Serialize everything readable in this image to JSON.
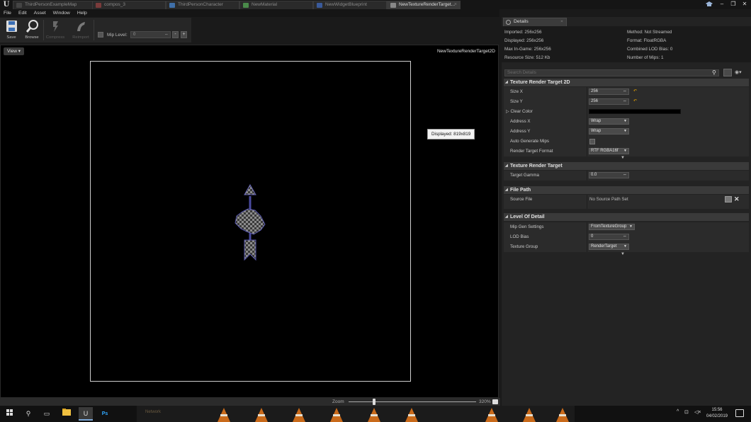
{
  "tabs": [
    {
      "label": "ThirdPersonExampleMap",
      "icon": "level-icon"
    },
    {
      "label": "compos_3",
      "icon": "animation-icon"
    },
    {
      "label": "ThirdPersonCharacter",
      "icon": "blueprint-icon"
    },
    {
      "label": "NewMaterial",
      "icon": "material-icon"
    },
    {
      "label": "NewWidgetBlueprint",
      "icon": "widget-icon"
    },
    {
      "label": "NewTextureRenderTarget...",
      "icon": "texture-icon"
    }
  ],
  "menu": [
    "File",
    "Edit",
    "Asset",
    "Window",
    "Help"
  ],
  "toolbar": {
    "save": "Save",
    "browse": "Browse",
    "compress": "Compress",
    "reimport": "Reimport",
    "mip_level_label": "Mip Level:",
    "mip_level_value": "0",
    "minus": "-",
    "plus": "+"
  },
  "viewport": {
    "view_button": "View ▾",
    "texture_name": "NewTextureRenderTarget2D",
    "tooltip": "Displayed: 819x819"
  },
  "zoom": {
    "label": "Zoom",
    "value": "320%",
    "level": 0.2
  },
  "details": {
    "tab_label": "Details",
    "info_left": [
      "Imported: 256x256",
      "Displayed: 256x256",
      "Max In-Game: 256x256",
      "Resource Size: 512 Kb"
    ],
    "info_right": [
      "Method: Not Streamed",
      "Format: FloatRGBA",
      "Combined LOD Bias: 0",
      "Number of Mips: 1"
    ],
    "search_placeholder": "Search Details",
    "sections": {
      "render_target_2d": {
        "title": "Texture Render Target 2D",
        "size_x_label": "Size X",
        "size_x": "256",
        "size_y_label": "Size Y",
        "size_y": "256",
        "clear_color_label": "Clear Color",
        "address_x_label": "Address X",
        "address_x": "Wrap",
        "address_y_label": "Address Y",
        "address_y": "Wrap",
        "auto_mips_label": "Auto Generate Mips",
        "format_label": "Render Target Format",
        "format": "RTF RGBA16f"
      },
      "render_target": {
        "title": "Texture Render Target",
        "gamma_label": "Target Gamma",
        "gamma": "0.0"
      },
      "file_path": {
        "title": "File Path",
        "source_label": "Source File",
        "source_value": "No Source Path Set"
      },
      "lod": {
        "title": "Level Of Detail",
        "mip_gen_label": "Mip Gen Settings",
        "mip_gen": "FromTextureGroup",
        "lod_bias_label": "LOD Bias",
        "lod_bias": "0",
        "texture_group_label": "Texture Group",
        "texture_group": "RenderTarget"
      }
    }
  },
  "taskbar": {
    "network_label": "Network",
    "time": "15:56",
    "date": "04/02/2019"
  },
  "colors": {
    "accent_orange": "#e8a400",
    "panel_bg": "#232323",
    "viewport_bg": "#000000"
  }
}
